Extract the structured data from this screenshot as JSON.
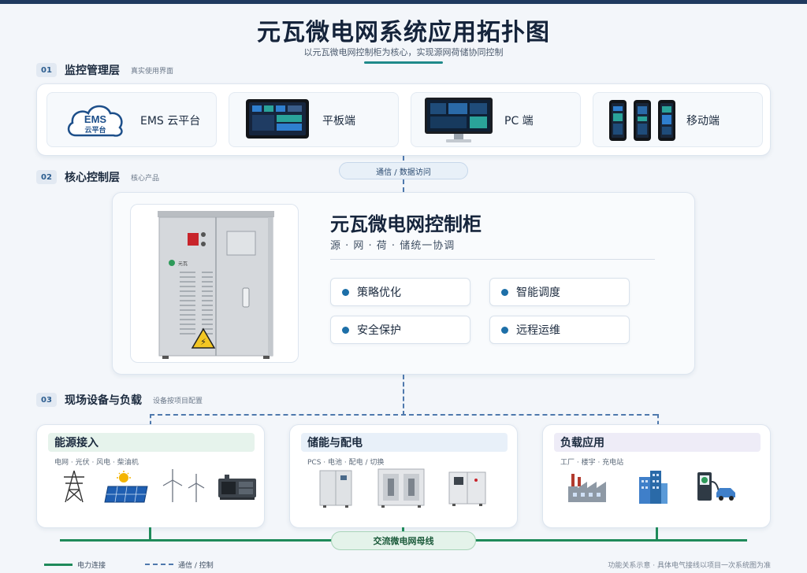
{
  "header": {
    "title": "元瓦微电网系统应用拓扑图",
    "subtitle": "以元瓦微电网控制柜为核心，实现源网荷储协同控制"
  },
  "layers": [
    {
      "num": "01",
      "name": "监控管理层",
      "sub": "真实使用界面"
    },
    {
      "num": "02",
      "name": "核心控制层",
      "sub": "核心产品"
    },
    {
      "num": "03",
      "name": "现场设备与负载",
      "sub": "设备按项目配置"
    }
  ],
  "monitor": {
    "tiles": [
      {
        "label": "EMS 云平台",
        "icon": "ems-cloud-icon",
        "logo_text": "EMS",
        "logo_sub": "云平台"
      },
      {
        "label": "平板端",
        "icon": "tablet-icon"
      },
      {
        "label": "PC 端",
        "icon": "monitor-icon"
      },
      {
        "label": "移动端",
        "icon": "phone-icon"
      }
    ]
  },
  "link_comm": "通信 / 数据访问",
  "core": {
    "title": "元瓦微电网控制柜",
    "subtitle": "源 · 网 · 荷 · 储统一协调",
    "cabinet_badge": "元瓦",
    "features": [
      "策略优化",
      "智能调度",
      "安全保护",
      "远程运维"
    ]
  },
  "field": [
    {
      "title": "能源接入",
      "sub": "电网 · 光伏 · 风电 · 柴油机",
      "tint": "#e6f3ec",
      "icons": [
        "power-tower-icon",
        "solar-panel-icon",
        "wind-turbine-icon",
        "diesel-generator-icon"
      ]
    },
    {
      "title": "储能与配电",
      "sub": "PCS · 电池 · 配电 / 切换",
      "tint": "#e8f0f9",
      "icons": [
        "pcs-cabinet-icon",
        "battery-cabinet-icon",
        "distribution-cabinet-icon"
      ]
    },
    {
      "title": "负载应用",
      "sub": "工厂 · 楼宇 · 充电站",
      "tint": "#eeecf7",
      "icons": [
        "factory-icon",
        "building-icon",
        "charging-station-icon"
      ]
    }
  ],
  "bus_label": "交流微电网母线",
  "legend": {
    "power": "电力连接",
    "comm": "通信 / 控制",
    "note": "功能关系示意 · 具体电气接线以项目一次系统图为准"
  },
  "colors": {
    "accent": "#1f8a8a",
    "bus": "#1f8a5a",
    "comm": "#4f79ad",
    "dot": "#1d6fa8"
  }
}
